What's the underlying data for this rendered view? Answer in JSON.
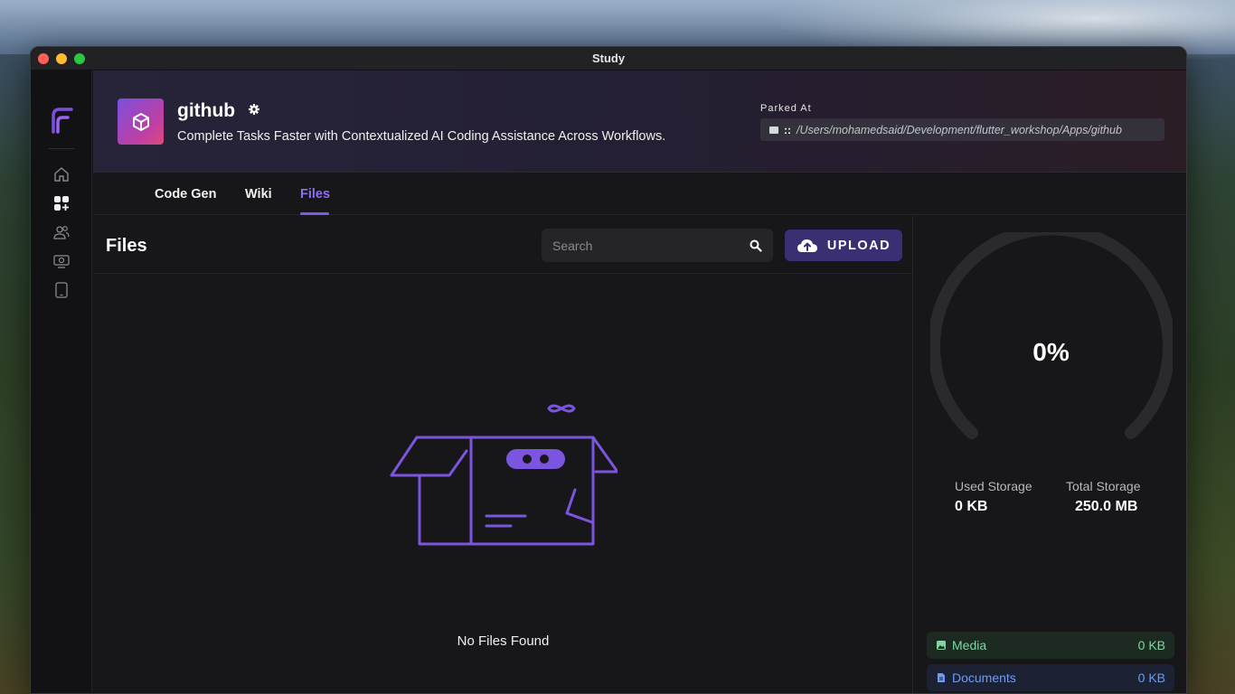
{
  "window": {
    "title": "Study"
  },
  "header": {
    "app_name": "github",
    "description": "Complete Tasks Faster with Contextualized AI Coding Assistance Across Workflows.",
    "parked_label": "Parked At",
    "path_separator": "::",
    "path": "/Users/mohamedsaid/Development/flutter_workshop/Apps/github"
  },
  "tabs": [
    {
      "label": "Code Gen",
      "active": false
    },
    {
      "label": "Wiki",
      "active": false
    },
    {
      "label": "Files",
      "active": true
    }
  ],
  "files": {
    "title": "Files",
    "search_placeholder": "Search",
    "upload_label": "UPLOAD",
    "empty_text": "No Files Found"
  },
  "storage": {
    "percent": "0%",
    "used_label": "Used Storage",
    "used_value": "0 KB",
    "total_label": "Total Storage",
    "total_value": "250.0 MB",
    "categories": [
      {
        "name": "Media",
        "value": "0 KB",
        "color": "#7fd6a0"
      },
      {
        "name": "Documents",
        "value": "0 KB",
        "color": "#6f9cf0"
      }
    ]
  },
  "colors": {
    "accent": "#7e5ae8",
    "upload_bg": "#3a2f72"
  }
}
